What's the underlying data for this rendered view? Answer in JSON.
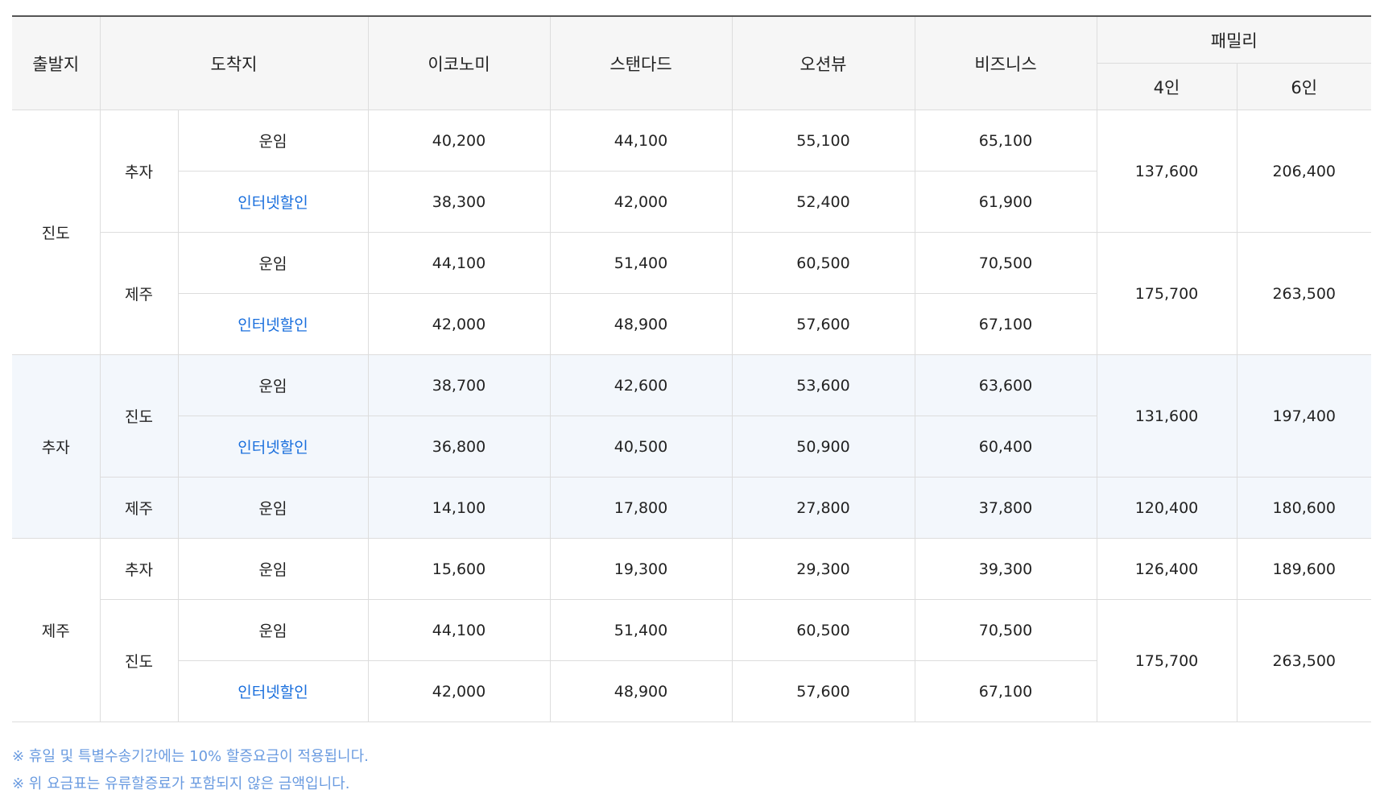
{
  "header": {
    "departure": "출발지",
    "arrival": "도착지",
    "economy": "이코노미",
    "standard": "스탠다드",
    "oceanview": "오션뷰",
    "business": "비즈니스",
    "family": "패밀리",
    "family_4": "4인",
    "family_6": "6인"
  },
  "rows": [
    {
      "from": "진도",
      "to": "추자",
      "type": "운임",
      "economy": "40,200",
      "standard": "44,100",
      "oceanview": "55,100",
      "business": "65,100",
      "f4": "137,600",
      "f6": "206,400"
    },
    {
      "type": "인터넷할인",
      "economy": "38,300",
      "standard": "42,000",
      "oceanview": "52,400",
      "business": "61,900"
    },
    {
      "to": "제주",
      "type": "운임",
      "economy": "44,100",
      "standard": "51,400",
      "oceanview": "60,500",
      "business": "70,500",
      "f4": "175,700",
      "f6": "263,500"
    },
    {
      "type": "인터넷할인",
      "economy": "42,000",
      "standard": "48,900",
      "oceanview": "57,600",
      "business": "67,100"
    },
    {
      "from": "추자",
      "to": "진도",
      "type": "운임",
      "economy": "38,700",
      "standard": "42,600",
      "oceanview": "53,600",
      "business": "63,600",
      "f4": "131,600",
      "f6": "197,400"
    },
    {
      "type": "인터넷할인",
      "economy": "36,800",
      "standard": "40,500",
      "oceanview": "50,900",
      "business": "60,400"
    },
    {
      "to": "제주",
      "type": "운임",
      "economy": "14,100",
      "standard": "17,800",
      "oceanview": "27,800",
      "business": "37,800",
      "f4": "120,400",
      "f6": "180,600"
    },
    {
      "from": "제주",
      "to": "추자",
      "type": "운임",
      "economy": "15,600",
      "standard": "19,300",
      "oceanview": "29,300",
      "business": "39,300",
      "f4": "126,400",
      "f6": "189,600"
    },
    {
      "to": "진도",
      "type": "운임",
      "economy": "44,100",
      "standard": "51,400",
      "oceanview": "60,500",
      "business": "70,500",
      "f4": "175,700",
      "f6": "263,500"
    },
    {
      "type": "인터넷할인",
      "economy": "42,000",
      "standard": "48,900",
      "oceanview": "57,600",
      "business": "67,100"
    }
  ],
  "notes": [
    "※ 휴일 및 특별수송기간에는 10% 할증요금이 적용됩니다.",
    "※ 위 요금표는 유류할증료가 포함되지 않은 금액입니다."
  ],
  "colors": {
    "discount_text": "#1a6fdd",
    "note_text": "#6a9be0",
    "header_bg": "#f6f6f6",
    "alt_row_bg": "#f3f7fc",
    "border": "#dddddd"
  }
}
